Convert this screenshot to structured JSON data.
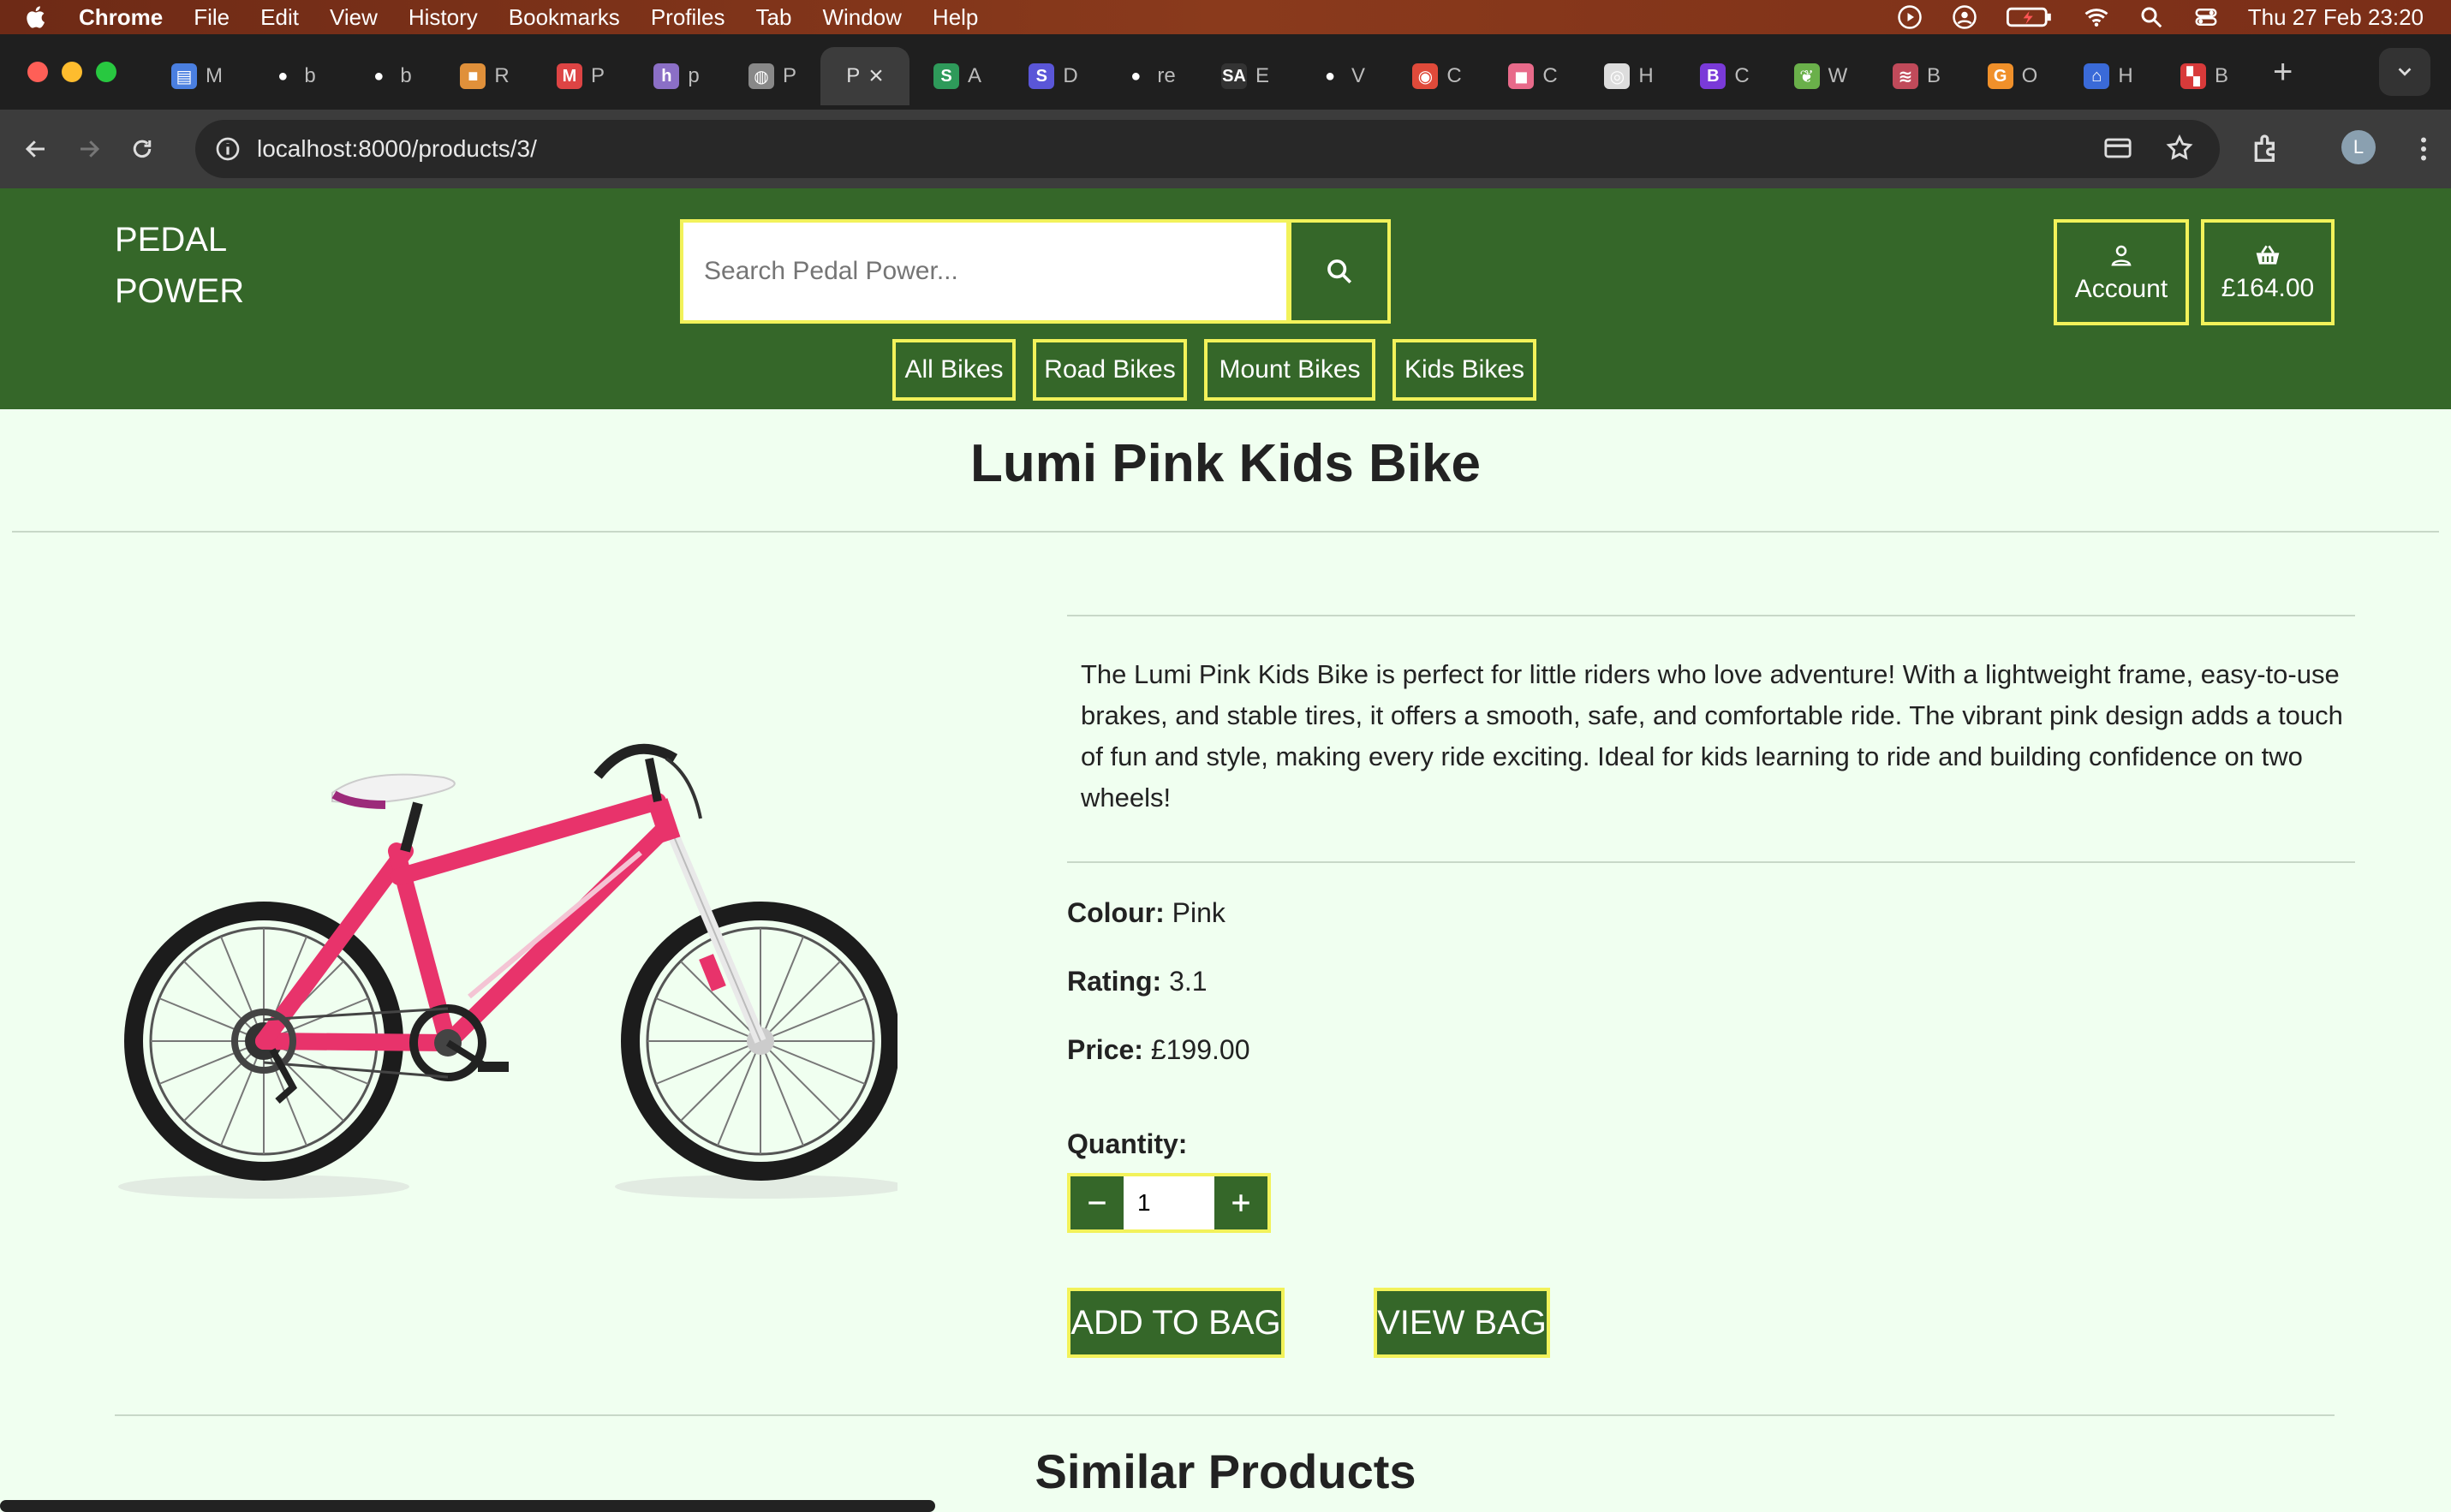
{
  "menubar": {
    "app_name": "Chrome",
    "items": [
      "File",
      "Edit",
      "View",
      "History",
      "Bookmarks",
      "Profiles",
      "Tab",
      "Window",
      "Help"
    ],
    "datetime": "Thu 27 Feb  23:20"
  },
  "tabs": [
    {
      "fav": "▤",
      "color": "#4a7fe0",
      "label": "M"
    },
    {
      "fav": "●",
      "color": "#fff",
      "label": "b"
    },
    {
      "fav": "●",
      "color": "#fff",
      "label": "b"
    },
    {
      "fav": "■",
      "color": "#e0903a",
      "label": "R"
    },
    {
      "fav": "M",
      "color": "#d44",
      "label": "P"
    },
    {
      "fav": "h",
      "color": "#8b6fc6",
      "label": "p"
    },
    {
      "fav": "◍",
      "color": "#888",
      "label": "P"
    },
    {
      "fav": "",
      "color": "#3c3c3c",
      "label": "P",
      "active": true
    },
    {
      "fav": "S",
      "color": "#2e9a5a",
      "label": "A"
    },
    {
      "fav": "S",
      "color": "#5a56d8",
      "label": "D"
    },
    {
      "fav": "●",
      "color": "#fff",
      "label": "re"
    },
    {
      "fav": "SA",
      "color": "#333",
      "label": "E"
    },
    {
      "fav": "●",
      "color": "#fff",
      "label": "V"
    },
    {
      "fav": "◉",
      "color": "#e04a3a",
      "label": "C"
    },
    {
      "fav": "◼",
      "color": "#e86a8a",
      "label": "C"
    },
    {
      "fav": "◎",
      "color": "#ddd",
      "label": "H"
    },
    {
      "fav": "B",
      "color": "#7a3ad8",
      "label": "C"
    },
    {
      "fav": "❦",
      "color": "#6ab04a",
      "label": "W"
    },
    {
      "fav": "≋",
      "color": "#c04a5a",
      "label": "B"
    },
    {
      "fav": "G",
      "color": "#f0902a",
      "label": "O"
    },
    {
      "fav": "⌂",
      "color": "#3a6ad8",
      "label": "H"
    },
    {
      "fav": "▚",
      "color": "#d83a3a",
      "label": "B"
    }
  ],
  "toolbar": {
    "url": "localhost:8000/products/3/",
    "profile_initial": "L"
  },
  "site": {
    "logo_line1": "PEDAL",
    "logo_line2": "POWER",
    "search_placeholder": "Search Pedal Power...",
    "account_label": "Account",
    "bag_total": "£164.00",
    "categories": [
      "All Bikes",
      "Road Bikes",
      "Mount Bikes",
      "Kids Bikes"
    ],
    "accent_color": "#356729",
    "highlight_color": "#f2f25a"
  },
  "product": {
    "title": "Lumi Pink Kids Bike",
    "description": "The Lumi Pink Kids Bike is perfect for little riders who love adventure! With a lightweight frame, easy-to-use brakes, and stable tires, it offers a smooth, safe, and comfortable ride. The vibrant pink design adds a touch of fun and style, making every ride exciting. Ideal for kids learning to ride and building confidence on two wheels!",
    "colour_label": "Colour:",
    "colour_value": "Pink",
    "rating_label": "Rating:",
    "rating_value": "3.1",
    "price_label": "Price:",
    "price_value": "£199.00",
    "quantity_label": "Quantity:",
    "quantity_value": "1",
    "add_to_bag": "ADD TO BAG",
    "view_bag": "VIEW BAG"
  },
  "similar_heading": "Similar Products"
}
